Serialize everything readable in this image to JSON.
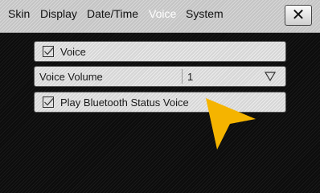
{
  "tabs": [
    {
      "label": "Skin",
      "active": false
    },
    {
      "label": "Display",
      "active": false
    },
    {
      "label": "Date/Time",
      "active": false
    },
    {
      "label": "Voice",
      "active": true
    },
    {
      "label": "System",
      "active": false
    }
  ],
  "close_glyph": "✕",
  "settings": {
    "voice": {
      "label": "Voice",
      "checked": true
    },
    "voice_volume": {
      "label": "Voice Volume",
      "value": "1"
    },
    "bluetooth_voice": {
      "label": "Play Bluetooth Status Voice",
      "checked": true
    }
  },
  "icons": {
    "checkbox": "checkbox-icon",
    "dropdown": "triangle-down-icon",
    "pointer": "pointer-arrow-icon"
  },
  "colors": {
    "active_tab": "#ffffff",
    "pointer": "#f5b400"
  }
}
